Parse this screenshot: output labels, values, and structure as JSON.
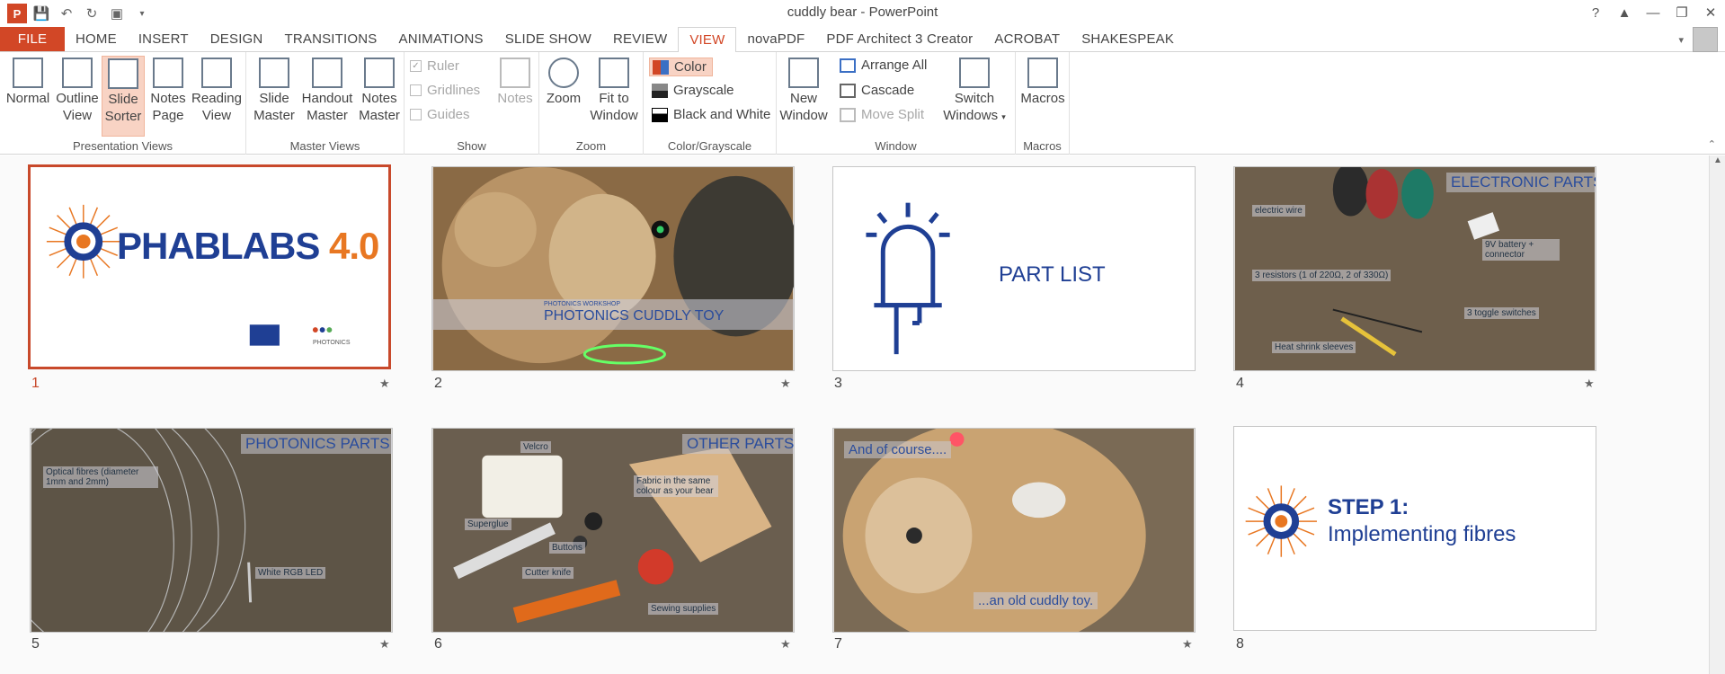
{
  "window": {
    "title": "cuddly bear - PowerPoint"
  },
  "qat": {
    "app_icon": "P",
    "undo_icon": "undo-icon",
    "redo_icon": "redo-icon"
  },
  "tabs": [
    "FILE",
    "HOME",
    "INSERT",
    "DESIGN",
    "TRANSITIONS",
    "ANIMATIONS",
    "SLIDE SHOW",
    "REVIEW",
    "VIEW",
    "novaPDF",
    "PDF Architect 3 Creator",
    "ACROBAT",
    "SHAKESPEAK"
  ],
  "active_tab": "VIEW",
  "ribbon": {
    "presentation_views": {
      "label": "Presentation Views",
      "normal": [
        "Normal",
        ""
      ],
      "outline": [
        "Outline",
        "View"
      ],
      "sorter": [
        "Slide",
        "Sorter"
      ],
      "notes": [
        "Notes",
        "Page"
      ],
      "reading": [
        "Reading",
        "View"
      ]
    },
    "master_views": {
      "label": "Master Views",
      "slide": [
        "Slide",
        "Master"
      ],
      "handout": [
        "Handout",
        "Master"
      ],
      "notes": [
        "Notes",
        "Master"
      ]
    },
    "show": {
      "label": "Show",
      "ruler": "Ruler",
      "gridlines": "Gridlines",
      "guides": "Guides",
      "notes": "Notes"
    },
    "zoom": {
      "label": "Zoom",
      "zoom": "Zoom",
      "fit": [
        "Fit to",
        "Window"
      ]
    },
    "color": {
      "label": "Color/Grayscale",
      "color": "Color",
      "grayscale": "Grayscale",
      "bw": "Black and White"
    },
    "window": {
      "label": "Window",
      "new": [
        "New",
        "Window"
      ],
      "arrange": "Arrange All",
      "cascade": "Cascade",
      "move": "Move Split",
      "switch": [
        "Switch",
        "Windows"
      ]
    },
    "macros": {
      "label": "Macros",
      "macros": "Macros"
    }
  },
  "slides": [
    {
      "num": "1",
      "logo": "PHABLABS",
      "logo_num": "4.0",
      "sub": "PHOTONICS"
    },
    {
      "num": "2",
      "small": "PHOTONICS WORKSHOP",
      "title": "PHOTONICS CUDDLY TOY"
    },
    {
      "num": "3",
      "title": "PART LIST"
    },
    {
      "num": "4",
      "title": "ELECTRONIC PARTS",
      "labels": [
        "electric wire",
        "9V battery + connector",
        "3 resistors (1 of 220Ω, 2 of 330Ω)",
        "3 toggle switches",
        "Heat shrink sleeves"
      ]
    },
    {
      "num": "5",
      "title": "PHOTONICS PARTS",
      "labels": [
        "Optical fibres (diameter 1mm and 2mm)",
        "White RGB LED"
      ]
    },
    {
      "num": "6",
      "title": "OTHER PARTS",
      "labels": [
        "Velcro",
        "Fabric in the same colour as your bear",
        "Superglue",
        "Buttons",
        "Cutter knife",
        "Sewing supplies"
      ]
    },
    {
      "num": "7",
      "top": "And of course....",
      "bottom": "...an old cuddly toy."
    },
    {
      "num": "8",
      "step": "STEP 1:",
      "sub": "Implementing fibres"
    }
  ],
  "colors": {
    "accent": "#d24726",
    "navy": "#1f3f94",
    "orange": "#e87722"
  }
}
